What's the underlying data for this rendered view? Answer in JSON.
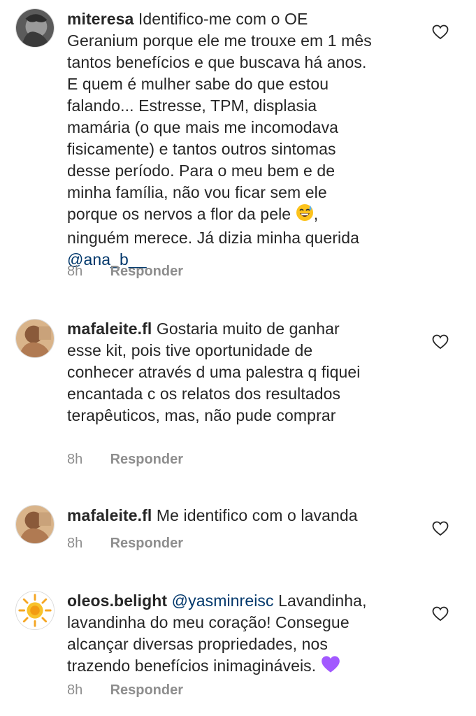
{
  "comments": [
    {
      "username": "miteresa",
      "text": "Identifico-me com o OE Geranium porque ele me trouxe em 1 mês tantos benefícios e que buscava há anos. E quem é mulher sabe do que estou falando... Estresse, TPM, displasia mamária (o que mais me incomodava fisicamente) e tantos outros sintomas desse período. Para o meu bem e de minha família, não vou ficar sem ele porque os nervos a flor da pele",
      "emoji": "sweat-smile-emoji",
      "text_after": ", ninguém merece. Já dizia minha querida",
      "mention": "@ana_b__",
      "time": "8h",
      "reply_label": "Responder"
    },
    {
      "username": "mafaleite.fl",
      "text": "Gostaria muito de ganhar esse kit, pois tive oportunidade de conhecer através d uma palestra  q fiquei encantada c os relatos  dos resultados terapêuticos, mas, não pude comprar",
      "time": "8h",
      "reply_label": "Responder"
    },
    {
      "username": "mafaleite.fl",
      "text": "Me identifico com o lavanda",
      "time": "8h",
      "reply_label": "Responder"
    },
    {
      "username": "oleos.belight",
      "mention": "@yasminreisc",
      "text": "Lavandinha, lavandinha do meu coração! Consegue alcançar diversas propriedades, nos trazendo benefícios inimagináveis.",
      "emoji": "purple-heart-emoji",
      "time": "8h",
      "reply_label": "Responder"
    }
  ],
  "colors": {
    "text": "#262626",
    "meta": "#8e8e8e",
    "mention": "#00376b",
    "emoji_purple": "#a259ff"
  }
}
